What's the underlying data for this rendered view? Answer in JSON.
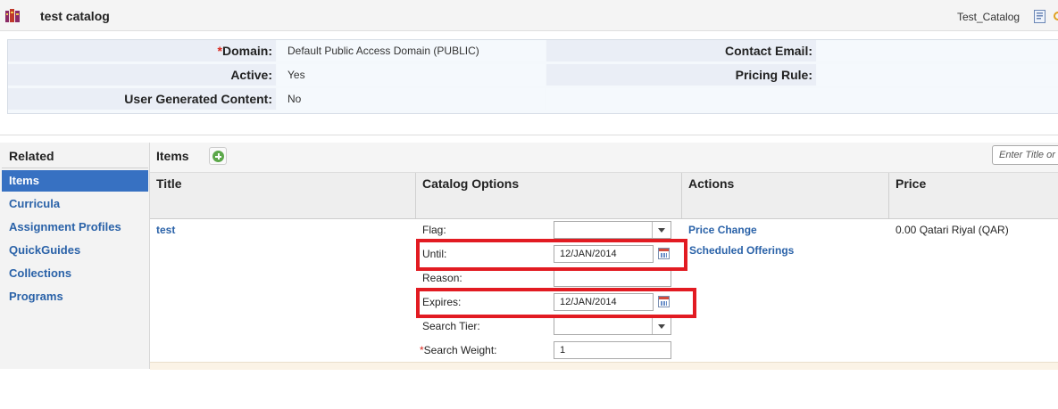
{
  "header": {
    "title": "test catalog",
    "catalog_code": "Test_Catalog",
    "app_icon": "catalog-books-icon",
    "doc_icon": "document-icon"
  },
  "details": {
    "domain_label": "Domain:",
    "domain_required": "*",
    "domain_value": "Default Public Access Domain (PUBLIC)",
    "active_label": "Active:",
    "active_value": "Yes",
    "ugc_label": "User Generated Content:",
    "ugc_value": "No",
    "contact_email_label": "Contact Email:",
    "contact_email_value": "",
    "pricing_rule_label": "Pricing Rule:",
    "pricing_rule_value": ""
  },
  "sidebar": {
    "title": "Related",
    "items": [
      {
        "label": "Items",
        "active": true
      },
      {
        "label": "Curricula",
        "active": false
      },
      {
        "label": "Assignment Profiles",
        "active": false
      },
      {
        "label": "QuickGuides",
        "active": false
      },
      {
        "label": "Collections",
        "active": false
      },
      {
        "label": "Programs",
        "active": false
      }
    ]
  },
  "items": {
    "title": "Items",
    "add_icon": "add-icon",
    "search_placeholder": "Enter Title or",
    "columns": [
      "Title",
      "Catalog Options",
      "Actions",
      "Price"
    ],
    "row": {
      "title": "test",
      "options": {
        "flag_label": "Flag:",
        "flag_value": "",
        "until_label": "Until:",
        "until_value": "12/JAN/2014",
        "reason_label": "Reason:",
        "reason_value": "",
        "expires_label": "Expires:",
        "expires_value": "12/JAN/2014",
        "search_tier_label": "Search Tier:",
        "search_tier_value": "",
        "search_weight_required": "*",
        "search_weight_label": "Search Weight:",
        "search_weight_value": "1"
      },
      "actions": [
        "Price Change",
        "Scheduled Offerings"
      ],
      "price": "0.00 Qatari Riyal (QAR)"
    }
  },
  "colors": {
    "highlight": "#e21b22",
    "link": "#2a62a8",
    "active_nav": "#3771c2"
  }
}
